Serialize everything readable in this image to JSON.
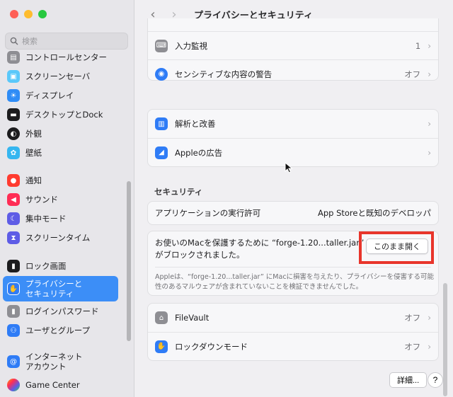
{
  "window": {
    "traffic_colors": [
      "#ff5f57",
      "#febc2e",
      "#28c840"
    ]
  },
  "search": {
    "placeholder": "検索"
  },
  "sidebar": {
    "items": [
      {
        "label": "コントロールセンター",
        "icon": "control-center-icon",
        "color": "#8e8e93"
      },
      {
        "label": "スクリーンセーバ",
        "icon": "screensaver-icon",
        "color": "#5ac8fa"
      },
      {
        "label": "ディスプレイ",
        "icon": "display-icon",
        "color": "#2f8cf6"
      },
      {
        "label": "デスクトップとDock",
        "icon": "dock-icon",
        "color": "#1c1c1e"
      },
      {
        "label": "外観",
        "icon": "appearance-icon",
        "color": "#1c1c1e"
      },
      {
        "label": "壁紙",
        "icon": "wallpaper-icon",
        "color": "#35b6f0"
      },
      {
        "label": "通知",
        "icon": "notification-icon",
        "color": "#ff3b30"
      },
      {
        "label": "サウンド",
        "icon": "sound-icon",
        "color": "#ff2d55"
      },
      {
        "label": "集中モード",
        "icon": "focus-icon",
        "color": "#5e5ce6"
      },
      {
        "label": "スクリーンタイム",
        "icon": "screen-time-icon",
        "color": "#5e5ce6"
      },
      {
        "label": "ロック画面",
        "icon": "lock-icon",
        "color": "#1c1c1e"
      },
      {
        "label_line1": "プライバシーと",
        "label_line2": "セキュリティ",
        "icon": "hand-icon",
        "color": "#2f7cf6",
        "active": true
      },
      {
        "label": "ログインパスワード",
        "icon": "password-lock-icon",
        "color": "#8e8e93"
      },
      {
        "label": "ユーザとグループ",
        "icon": "users-icon",
        "color": "#2f7cf6"
      },
      {
        "label_line1": "インターネット",
        "label_line2": "アカウント",
        "icon": "at-icon",
        "color": "#2f7cf6"
      },
      {
        "label": "Game Center",
        "icon": "game-center-icon",
        "color": "#ff9f0a"
      }
    ]
  },
  "toolbar": {
    "back": "‹",
    "forward": "›",
    "title": "プライバシーとセキュリティ"
  },
  "privacy_rows": [
    {
      "label": "入力監視",
      "value": "1",
      "icon": "keyboard-icon",
      "color": "#8e8e93"
    },
    {
      "label": "センシティブな内容の警告",
      "value": "オフ",
      "icon": "eye-warning-icon",
      "color": "#2f7cf6"
    },
    {
      "label": "解析と改善",
      "value": "",
      "icon": "chart-icon",
      "color": "#2f7cf6"
    },
    {
      "label": "Appleの広告",
      "value": "",
      "icon": "megaphone-icon",
      "color": "#2f7cf6"
    }
  ],
  "security": {
    "section_title": "セキュリティ",
    "app_permission_label": "アプリケーションの実行許可",
    "app_permission_value": "App Storeと既知のデベロッパ",
    "blocked_message": "お使いのMacを保護するために “forge-1.20...taller.jar” がブロックされました。",
    "open_anyway": "このまま開く",
    "note": "Appleは、“forge-1.20...taller.jar” にMacに損害を与えたり、プライバシーを侵害する可能性のあるマルウェアが含まれていないことを検証できませんでした。",
    "filevault_label": "FileVault",
    "filevault_value": "オフ",
    "lockdown_label": "ロックダウンモード",
    "lockdown_value": "オフ"
  },
  "footer": {
    "details": "詳細...",
    "help": "?"
  },
  "accent_color": "#3c8ef7",
  "highlight_color": "#e8352b"
}
